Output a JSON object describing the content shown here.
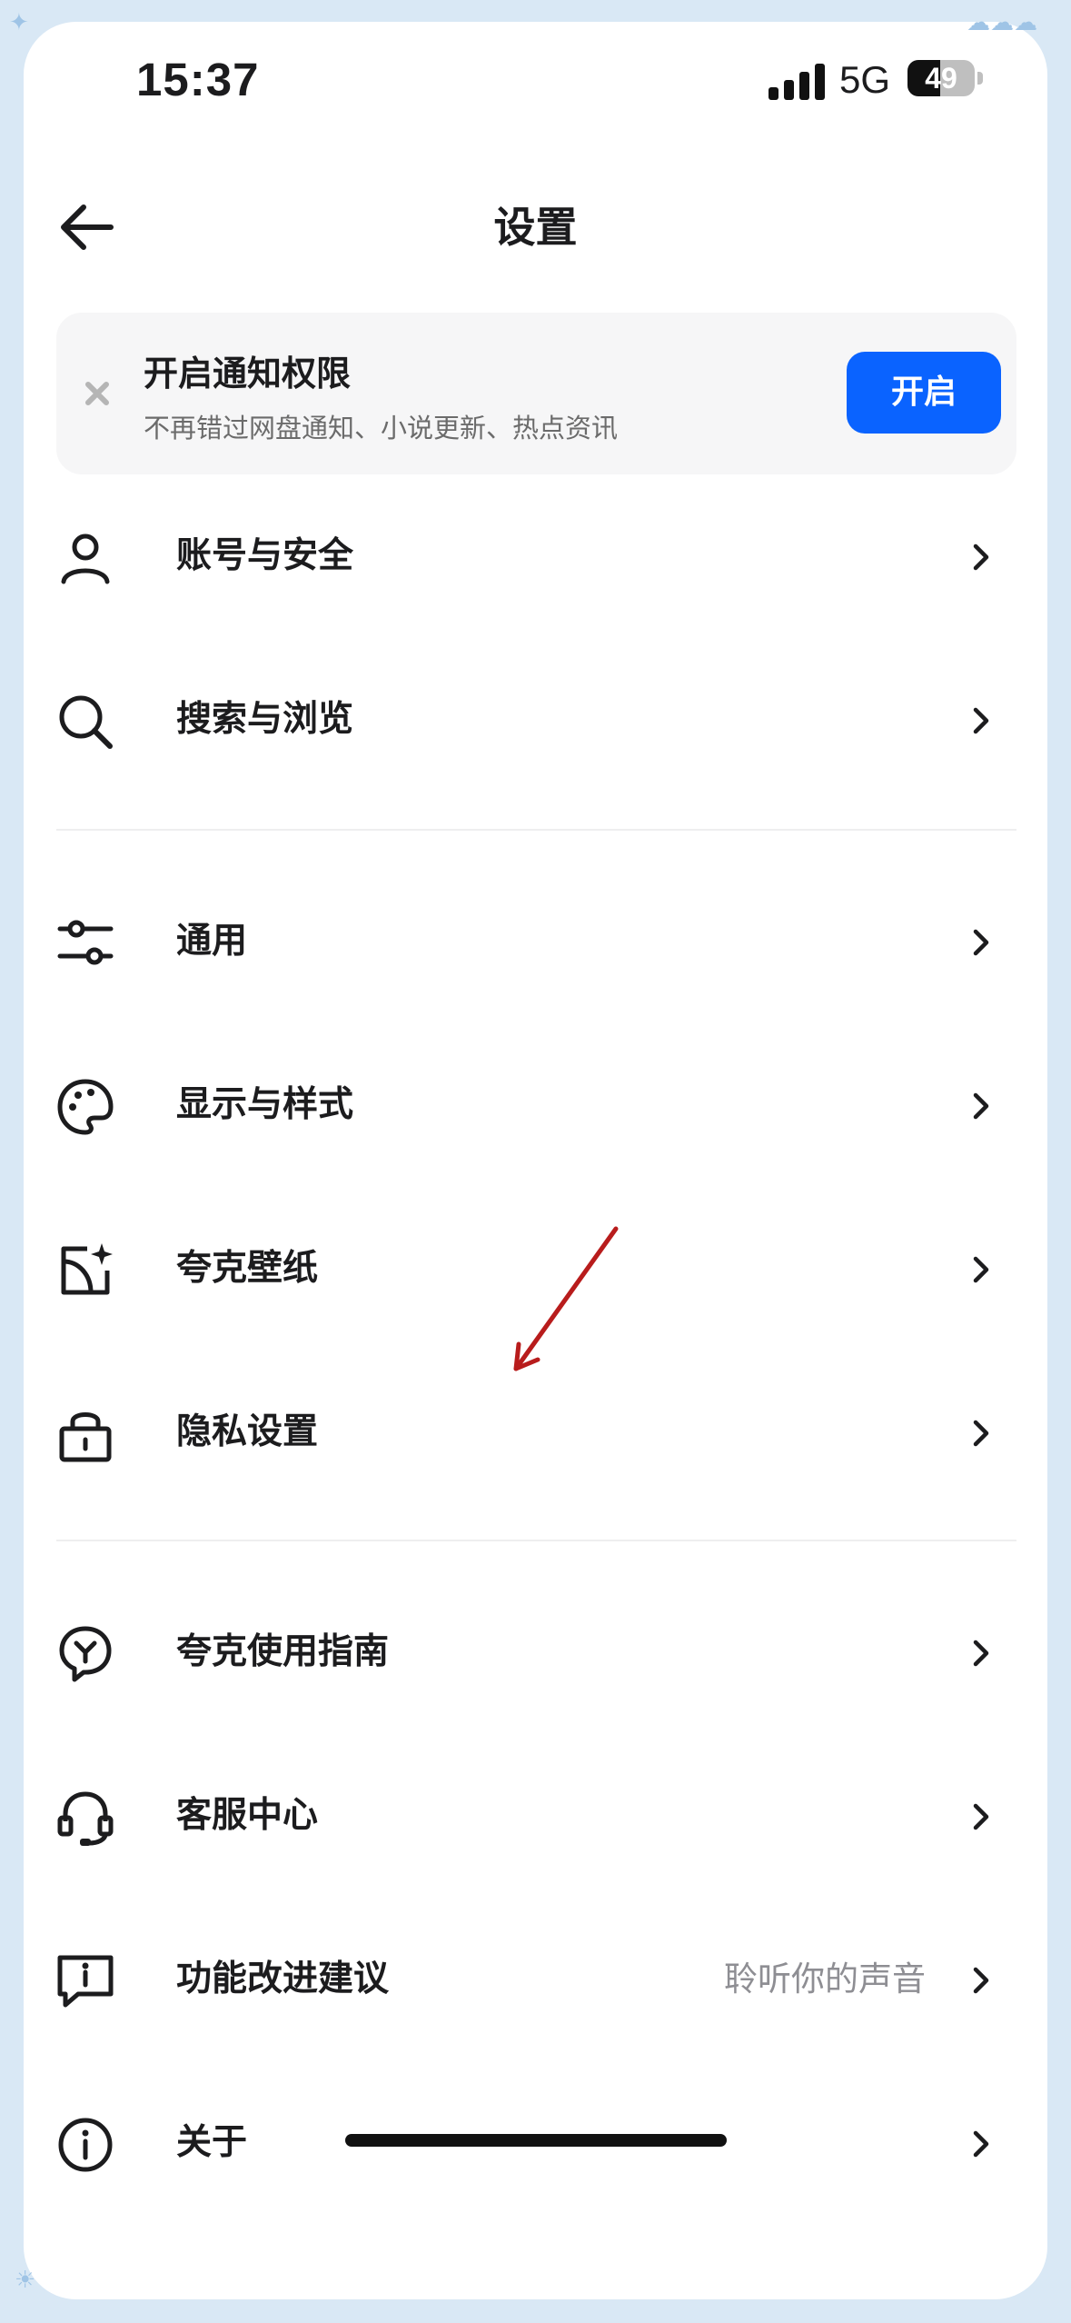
{
  "status_bar": {
    "time": "15:37",
    "network": "5G",
    "battery": "49",
    "battery_level": 0.49
  },
  "nav": {
    "title": "设置"
  },
  "banner": {
    "title": "开启通知权限",
    "subtitle": "不再错过网盘通知、小说更新、热点资讯",
    "button_label": "开启"
  },
  "settings": {
    "items": [
      {
        "label": "账号与安全",
        "icon": "user-icon"
      },
      {
        "label": "搜索与浏览",
        "icon": "search-icon"
      },
      {
        "label": "通用",
        "icon": "sliders-icon"
      },
      {
        "label": "显示与样式",
        "icon": "palette-icon"
      },
      {
        "label": "夸克壁纸",
        "icon": "wallpaper-sparkle-icon"
      },
      {
        "label": "隐私设置",
        "icon": "lock-icon"
      },
      {
        "label": "夸克使用指南",
        "icon": "lightbulb-icon"
      },
      {
        "label": "客服中心",
        "icon": "headset-icon"
      },
      {
        "label": "功能改进建议",
        "icon": "feedback-icon",
        "hint": "聆听你的声音"
      },
      {
        "label": "关于",
        "icon": "info-icon"
      }
    ]
  },
  "colors": {
    "accent": "#0a63ff",
    "annotation_arrow": "#b81c1c",
    "background": "#d9e8f5"
  }
}
